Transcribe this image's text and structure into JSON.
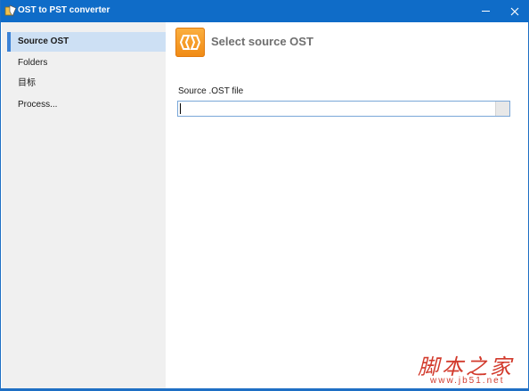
{
  "window": {
    "title": "OST to PST converter",
    "minimize_label": "—",
    "close_label": "✕"
  },
  "sidebar": {
    "items": [
      {
        "label": "Source OST",
        "active": true
      },
      {
        "label": "Folders",
        "active": false
      },
      {
        "label": "目标",
        "active": false
      },
      {
        "label": "Process...",
        "active": false
      }
    ]
  },
  "main": {
    "header_title": "Select source OST",
    "field_label": "Source .OST file",
    "file_value": "",
    "file_placeholder": ""
  },
  "watermark": {
    "text": "脚本之家",
    "url": "www.jb51.net"
  },
  "colors": {
    "titlebar": "#0f6cc8",
    "sidebar_bg": "#f0f0f0",
    "active_item": "#cde0f4",
    "accent": "#3b82d6",
    "header_icon": "#f39a1e",
    "watermark": "#d23a2c"
  },
  "icons": {
    "app": "app-icon",
    "header": "outlook-exchange-icon"
  }
}
